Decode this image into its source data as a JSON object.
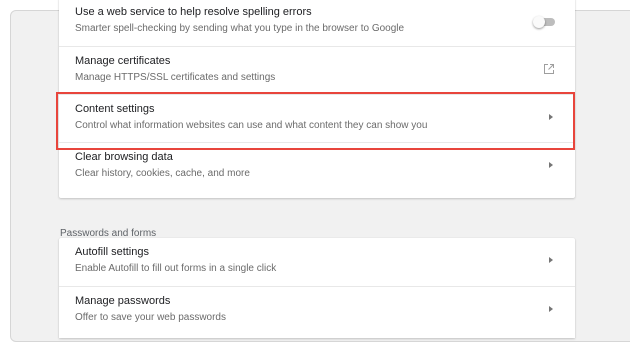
{
  "advanced_privacy": {
    "items": [
      {
        "title": "Use a web service to help resolve spelling errors",
        "subtitle": "Smarter spell-checking by sending what you type in the browser to Google",
        "control": "toggle",
        "toggle_on": false
      },
      {
        "title": "Manage certificates",
        "subtitle": "Manage HTTPS/SSL certificates and settings",
        "control": "launch-icon"
      },
      {
        "title": "Content settings",
        "subtitle": "Control what information websites can use and what content they can show you",
        "control": "arrow-right-icon",
        "highlighted": true
      },
      {
        "title": "Clear browsing data",
        "subtitle": "Clear history, cookies, cache, and more",
        "control": "arrow-right-icon"
      }
    ]
  },
  "passwords_and_forms": {
    "heading": "Passwords and forms",
    "items": [
      {
        "title": "Autofill settings",
        "subtitle": "Enable Autofill to fill out forms in a single click",
        "control": "arrow-right-icon"
      },
      {
        "title": "Manage passwords",
        "subtitle": "Offer to save your web passwords",
        "control": "arrow-right-icon"
      }
    ]
  },
  "colors": {
    "highlight_border": "#e8453c",
    "page_background": "#f1f1f1",
    "card_background": "#ffffff"
  }
}
